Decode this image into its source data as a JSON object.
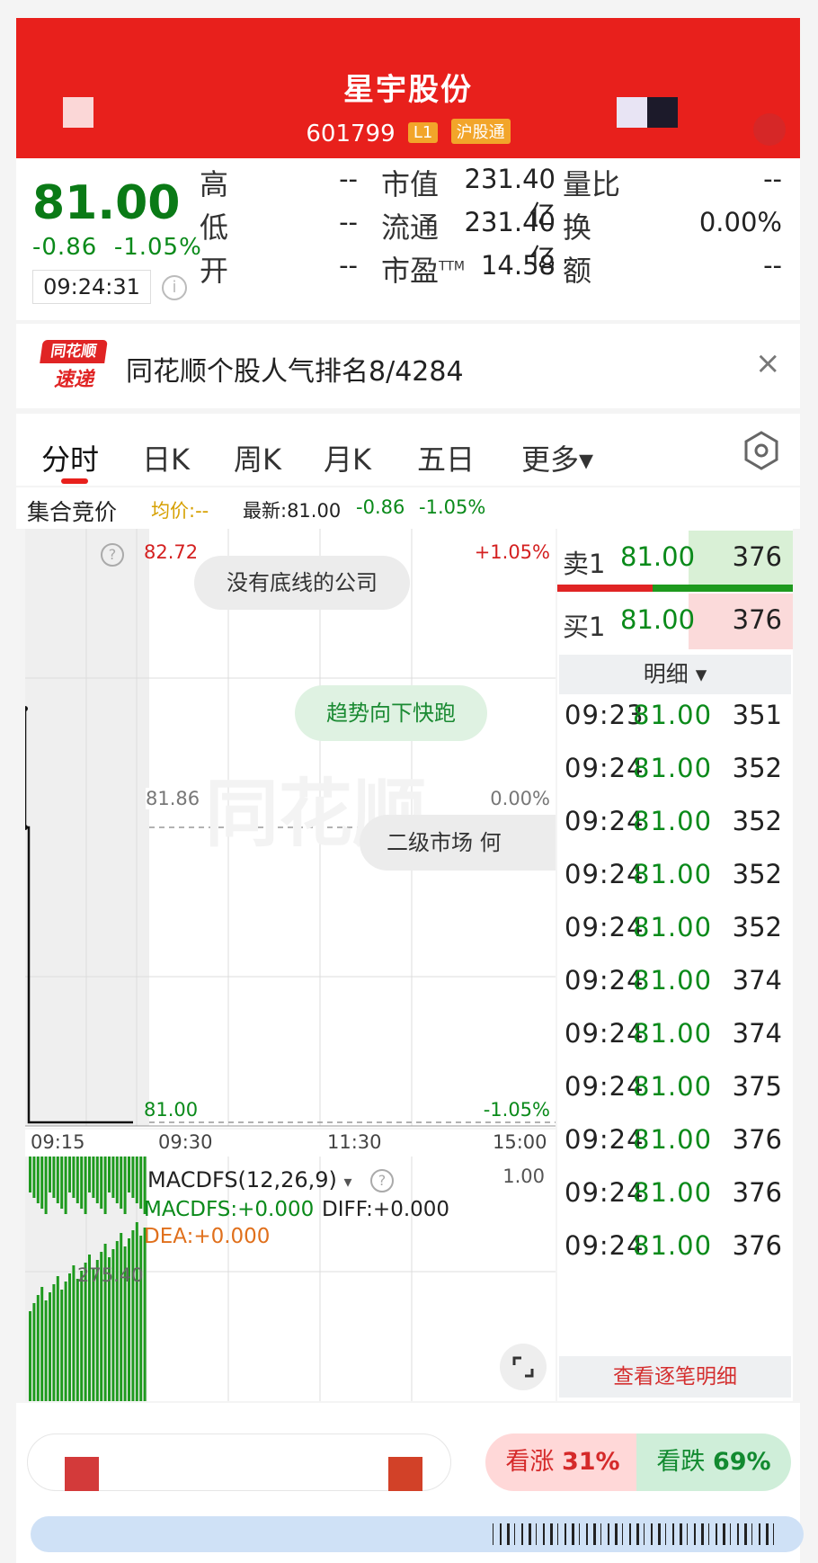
{
  "header": {
    "title": "星宇股份",
    "code": "601799",
    "tag_level": "L1",
    "tag_connect": "沪股通"
  },
  "quote": {
    "price": "81.00",
    "change": "-0.86",
    "change_pct": "-1.05%",
    "time": "09:24:31",
    "stats": [
      {
        "label": "高",
        "value": "--"
      },
      {
        "label": "低",
        "value": "--"
      },
      {
        "label": "开",
        "value": "--"
      }
    ],
    "market": [
      {
        "label": "市值",
        "value": "231.40亿"
      },
      {
        "label": "流通",
        "value": "231.40亿"
      },
      {
        "label": "市盈",
        "sup": "TTM",
        "value": "14.58"
      }
    ],
    "extra": [
      {
        "label": "量比",
        "value": "--"
      },
      {
        "label": "换",
        "value": "0.00%"
      },
      {
        "label": "额",
        "value": "--"
      }
    ]
  },
  "banner": {
    "logo_top": "同花顺",
    "logo_bottom": "速递",
    "text": "同花顺个股人气排名8/4284",
    "close": "×"
  },
  "tabs": [
    "分时",
    "日K",
    "周K",
    "月K",
    "五日",
    "更多▾"
  ],
  "subheader": {
    "mode": "集合竞价",
    "avg_label": "均价:--",
    "latest": "最新:81.00",
    "change": "-0.86",
    "change_pct": "-1.05%"
  },
  "chart": {
    "top_price": "82.72",
    "top_pct": "+1.05%",
    "mid_price": "81.86",
    "mid_pct": "0.00%",
    "bottom_price": "81.00",
    "bottom_pct": "-1.05%",
    "times": [
      "09:15",
      "09:30",
      "11:30",
      "15:00"
    ],
    "bubbles": [
      "没有底线的公司",
      "趋势向下快跑",
      "二级市场 何"
    ],
    "watermark": "同花顺",
    "help": "?"
  },
  "macd": {
    "name": "MACDFS(12,26,9)",
    "value1": "1.00",
    "macdfs": "MACDFS:+0.000",
    "diff": "DIFF:+0.000",
    "dea": "DEA:+0.000",
    "vol_label": "275.40"
  },
  "book": {
    "sell": {
      "label": "卖1",
      "price": "81.00",
      "vol": "376"
    },
    "buy": {
      "label": "买1",
      "price": "81.00",
      "vol": "376"
    },
    "detail_label": "明细 ▾",
    "rows": [
      {
        "time": "09:23",
        "price": "81.00",
        "vol": "351"
      },
      {
        "time": "09:24",
        "price": "81.00",
        "vol": "352"
      },
      {
        "time": "09:24",
        "price": "81.00",
        "vol": "352"
      },
      {
        "time": "09:24",
        "price": "81.00",
        "vol": "352"
      },
      {
        "time": "09:24",
        "price": "81.00",
        "vol": "352"
      },
      {
        "time": "09:24",
        "price": "81.00",
        "vol": "374"
      },
      {
        "time": "09:24",
        "price": "81.00",
        "vol": "374"
      },
      {
        "time": "09:24",
        "price": "81.00",
        "vol": "375"
      },
      {
        "time": "09:24",
        "price": "81.00",
        "vol": "376"
      },
      {
        "time": "09:24",
        "price": "81.00",
        "vol": "376"
      },
      {
        "time": "09:24",
        "price": "81.00",
        "vol": "376"
      }
    ],
    "more": "查看逐笔明细"
  },
  "vote": {
    "bull_label": "看涨",
    "bull_pct": "31%",
    "bear_label": "看跌",
    "bear_pct": "69%"
  },
  "colors": {
    "brand_red": "#e8201c",
    "down_green": "#0a8a1a",
    "up_red": "#d42020"
  }
}
